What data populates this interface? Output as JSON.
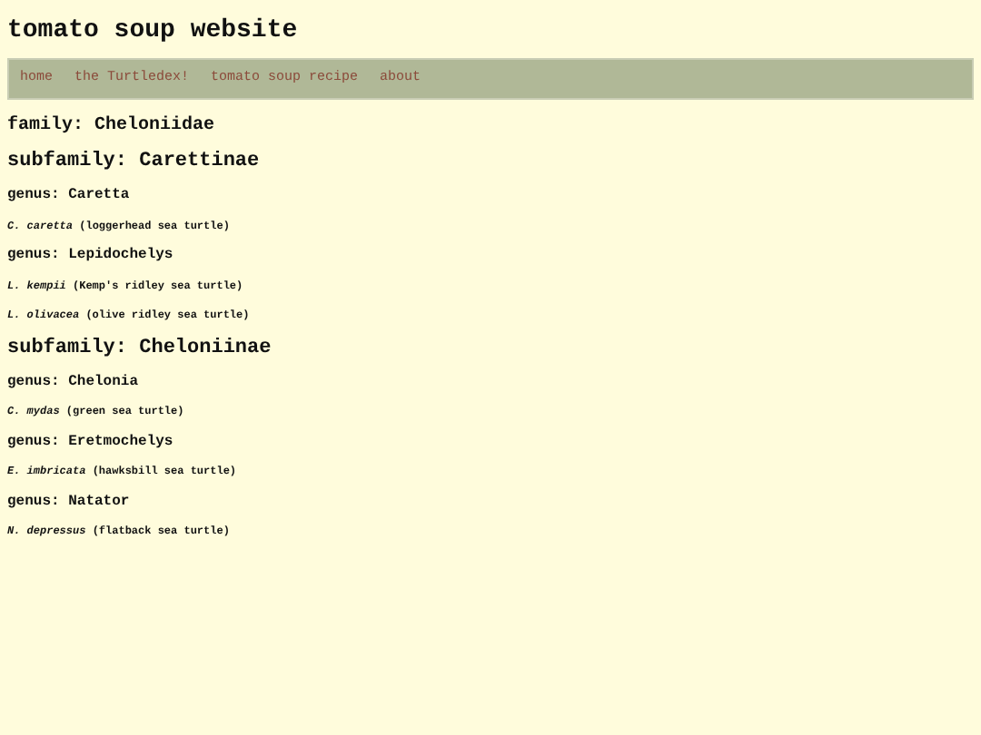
{
  "site_title": "tomato soup website",
  "nav": [
    {
      "label": "home"
    },
    {
      "label": "the Turtledex!"
    },
    {
      "label": "tomato soup recipe"
    },
    {
      "label": "about"
    }
  ],
  "taxonomy": [
    {
      "label": "family: Cheloniidae",
      "children": [
        {
          "label": "subfamily: Carettinae",
          "children": [
            {
              "label": "genus: Caretta",
              "children": [
                {
                  "label": "*C. caretta* (loggerhead sea turtle)"
                }
              ]
            },
            {
              "label": "genus: Lepidochelys",
              "children": [
                {
                  "label": "*L. kempii* (Kemp's ridley sea turtle)"
                },
                {
                  "label": "*L. olivacea* (olive ridley sea turtle)"
                }
              ]
            }
          ]
        },
        {
          "label": "subfamily: Cheloniinae",
          "children": [
            {
              "label": "genus: Chelonia",
              "children": [
                {
                  "label": "*C. mydas* (green sea turtle)"
                }
              ]
            },
            {
              "label": "genus: Eretmochelys",
              "children": [
                {
                  "label": "*E. imbricata* (hawksbill sea turtle)"
                }
              ]
            },
            {
              "label": "genus: Natator",
              "children": [
                {
                  "label": "*N. depressus* (flatback sea turtle)"
                }
              ]
            }
          ]
        }
      ]
    }
  ]
}
